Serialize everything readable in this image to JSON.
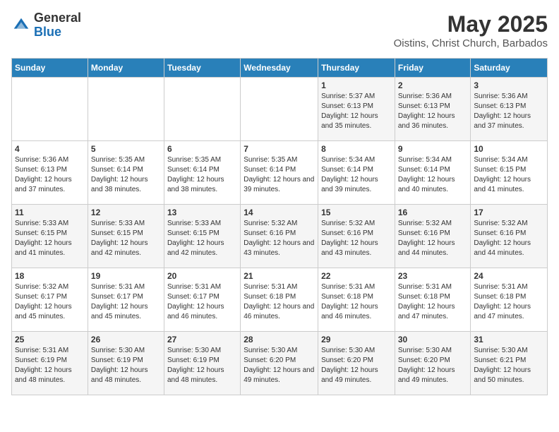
{
  "header": {
    "logo_general": "General",
    "logo_blue": "Blue",
    "title": "May 2025",
    "subtitle": "Oistins, Christ Church, Barbados"
  },
  "weekdays": [
    "Sunday",
    "Monday",
    "Tuesday",
    "Wednesday",
    "Thursday",
    "Friday",
    "Saturday"
  ],
  "weeks": [
    [
      {
        "day": "",
        "sunrise": "",
        "sunset": "",
        "daylight": ""
      },
      {
        "day": "",
        "sunrise": "",
        "sunset": "",
        "daylight": ""
      },
      {
        "day": "",
        "sunrise": "",
        "sunset": "",
        "daylight": ""
      },
      {
        "day": "",
        "sunrise": "",
        "sunset": "",
        "daylight": ""
      },
      {
        "day": "1",
        "sunrise": "Sunrise: 5:37 AM",
        "sunset": "Sunset: 6:13 PM",
        "daylight": "Daylight: 12 hours and 35 minutes."
      },
      {
        "day": "2",
        "sunrise": "Sunrise: 5:36 AM",
        "sunset": "Sunset: 6:13 PM",
        "daylight": "Daylight: 12 hours and 36 minutes."
      },
      {
        "day": "3",
        "sunrise": "Sunrise: 5:36 AM",
        "sunset": "Sunset: 6:13 PM",
        "daylight": "Daylight: 12 hours and 37 minutes."
      }
    ],
    [
      {
        "day": "4",
        "sunrise": "Sunrise: 5:36 AM",
        "sunset": "Sunset: 6:13 PM",
        "daylight": "Daylight: 12 hours and 37 minutes."
      },
      {
        "day": "5",
        "sunrise": "Sunrise: 5:35 AM",
        "sunset": "Sunset: 6:14 PM",
        "daylight": "Daylight: 12 hours and 38 minutes."
      },
      {
        "day": "6",
        "sunrise": "Sunrise: 5:35 AM",
        "sunset": "Sunset: 6:14 PM",
        "daylight": "Daylight: 12 hours and 38 minutes."
      },
      {
        "day": "7",
        "sunrise": "Sunrise: 5:35 AM",
        "sunset": "Sunset: 6:14 PM",
        "daylight": "Daylight: 12 hours and 39 minutes."
      },
      {
        "day": "8",
        "sunrise": "Sunrise: 5:34 AM",
        "sunset": "Sunset: 6:14 PM",
        "daylight": "Daylight: 12 hours and 39 minutes."
      },
      {
        "day": "9",
        "sunrise": "Sunrise: 5:34 AM",
        "sunset": "Sunset: 6:14 PM",
        "daylight": "Daylight: 12 hours and 40 minutes."
      },
      {
        "day": "10",
        "sunrise": "Sunrise: 5:34 AM",
        "sunset": "Sunset: 6:15 PM",
        "daylight": "Daylight: 12 hours and 41 minutes."
      }
    ],
    [
      {
        "day": "11",
        "sunrise": "Sunrise: 5:33 AM",
        "sunset": "Sunset: 6:15 PM",
        "daylight": "Daylight: 12 hours and 41 minutes."
      },
      {
        "day": "12",
        "sunrise": "Sunrise: 5:33 AM",
        "sunset": "Sunset: 6:15 PM",
        "daylight": "Daylight: 12 hours and 42 minutes."
      },
      {
        "day": "13",
        "sunrise": "Sunrise: 5:33 AM",
        "sunset": "Sunset: 6:15 PM",
        "daylight": "Daylight: 12 hours and 42 minutes."
      },
      {
        "day": "14",
        "sunrise": "Sunrise: 5:32 AM",
        "sunset": "Sunset: 6:16 PM",
        "daylight": "Daylight: 12 hours and 43 minutes."
      },
      {
        "day": "15",
        "sunrise": "Sunrise: 5:32 AM",
        "sunset": "Sunset: 6:16 PM",
        "daylight": "Daylight: 12 hours and 43 minutes."
      },
      {
        "day": "16",
        "sunrise": "Sunrise: 5:32 AM",
        "sunset": "Sunset: 6:16 PM",
        "daylight": "Daylight: 12 hours and 44 minutes."
      },
      {
        "day": "17",
        "sunrise": "Sunrise: 5:32 AM",
        "sunset": "Sunset: 6:16 PM",
        "daylight": "Daylight: 12 hours and 44 minutes."
      }
    ],
    [
      {
        "day": "18",
        "sunrise": "Sunrise: 5:32 AM",
        "sunset": "Sunset: 6:17 PM",
        "daylight": "Daylight: 12 hours and 45 minutes."
      },
      {
        "day": "19",
        "sunrise": "Sunrise: 5:31 AM",
        "sunset": "Sunset: 6:17 PM",
        "daylight": "Daylight: 12 hours and 45 minutes."
      },
      {
        "day": "20",
        "sunrise": "Sunrise: 5:31 AM",
        "sunset": "Sunset: 6:17 PM",
        "daylight": "Daylight: 12 hours and 46 minutes."
      },
      {
        "day": "21",
        "sunrise": "Sunrise: 5:31 AM",
        "sunset": "Sunset: 6:18 PM",
        "daylight": "Daylight: 12 hours and 46 minutes."
      },
      {
        "day": "22",
        "sunrise": "Sunrise: 5:31 AM",
        "sunset": "Sunset: 6:18 PM",
        "daylight": "Daylight: 12 hours and 46 minutes."
      },
      {
        "day": "23",
        "sunrise": "Sunrise: 5:31 AM",
        "sunset": "Sunset: 6:18 PM",
        "daylight": "Daylight: 12 hours and 47 minutes."
      },
      {
        "day": "24",
        "sunrise": "Sunrise: 5:31 AM",
        "sunset": "Sunset: 6:18 PM",
        "daylight": "Daylight: 12 hours and 47 minutes."
      }
    ],
    [
      {
        "day": "25",
        "sunrise": "Sunrise: 5:31 AM",
        "sunset": "Sunset: 6:19 PM",
        "daylight": "Daylight: 12 hours and 48 minutes."
      },
      {
        "day": "26",
        "sunrise": "Sunrise: 5:30 AM",
        "sunset": "Sunset: 6:19 PM",
        "daylight": "Daylight: 12 hours and 48 minutes."
      },
      {
        "day": "27",
        "sunrise": "Sunrise: 5:30 AM",
        "sunset": "Sunset: 6:19 PM",
        "daylight": "Daylight: 12 hours and 48 minutes."
      },
      {
        "day": "28",
        "sunrise": "Sunrise: 5:30 AM",
        "sunset": "Sunset: 6:20 PM",
        "daylight": "Daylight: 12 hours and 49 minutes."
      },
      {
        "day": "29",
        "sunrise": "Sunrise: 5:30 AM",
        "sunset": "Sunset: 6:20 PM",
        "daylight": "Daylight: 12 hours and 49 minutes."
      },
      {
        "day": "30",
        "sunrise": "Sunrise: 5:30 AM",
        "sunset": "Sunset: 6:20 PM",
        "daylight": "Daylight: 12 hours and 49 minutes."
      },
      {
        "day": "31",
        "sunrise": "Sunrise: 5:30 AM",
        "sunset": "Sunset: 6:21 PM",
        "daylight": "Daylight: 12 hours and 50 minutes."
      }
    ]
  ]
}
